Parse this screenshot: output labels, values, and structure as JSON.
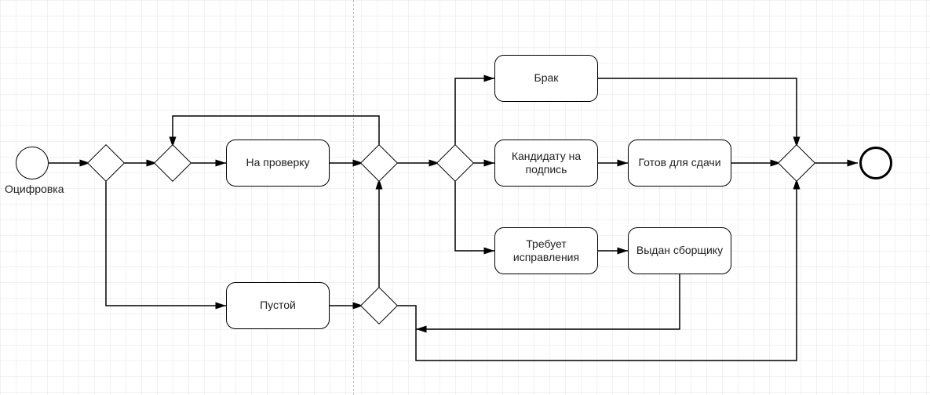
{
  "diagram": {
    "type": "bpmn-process",
    "start": {
      "label": "Оцифровка"
    },
    "tasks": {
      "na_proverku": "На проверку",
      "pustoy": "Пустой",
      "brak": "Брак",
      "kandidatu_na_podpis": "Кандидату на\nподпись",
      "gotov_dlya_sdachi": "Готов для сдачи",
      "trebuet_ispravleniya": "Требует\nисправления",
      "vydan_sborschiku": "Выдан сборщику"
    },
    "gateways": [
      "g1",
      "g2",
      "g3",
      "g4",
      "g5",
      "g6"
    ],
    "end": {
      "label": ""
    }
  }
}
